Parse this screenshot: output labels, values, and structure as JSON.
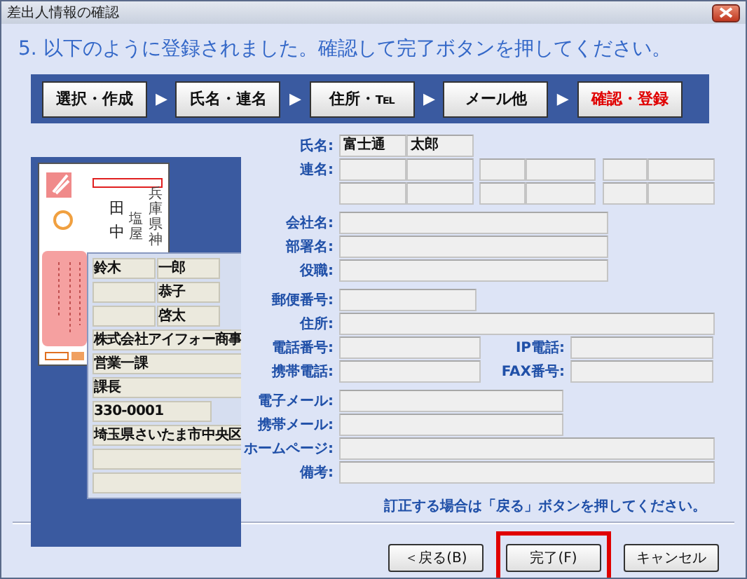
{
  "window": {
    "title": "差出人情報の確認"
  },
  "heading": "5. 以下のように登録されました。確認して完了ボタンを押してください。",
  "steps": [
    {
      "label": "選択・作成",
      "selected": false
    },
    {
      "label": "氏名・連名",
      "selected": false
    },
    {
      "label": "住所・℡",
      "selected": false
    },
    {
      "label": "メール他",
      "selected": false
    },
    {
      "label": "確認・登録",
      "selected": true
    }
  ],
  "step_separator": "▶",
  "preview": {
    "recipient": "田中",
    "address": [
      "塩屋",
      "兵庫県神"
    ],
    "entries": [
      {
        "kind": "name",
        "family": "鈴木",
        "given": "一郎"
      },
      {
        "kind": "name",
        "given": "恭子"
      },
      {
        "kind": "name",
        "given": "啓太"
      },
      {
        "kind": "wide",
        "value": "株式会社アイフォー商事"
      },
      {
        "kind": "wide",
        "value": "営業一課"
      },
      {
        "kind": "wide",
        "value": "課長"
      },
      {
        "kind": "postal",
        "value": "330-0001"
      },
      {
        "kind": "wide",
        "value": "埼玉県さいたま市中央区"
      },
      {
        "kind": "wide"
      },
      {
        "kind": "wide"
      }
    ]
  },
  "form": {
    "name": {
      "label": "氏名:",
      "family": "富士通",
      "given": "太郎"
    },
    "companions": {
      "label": "連名:"
    },
    "sections": [
      [
        {
          "kind": "medium",
          "label": "会社名:"
        },
        {
          "kind": "medium",
          "label": "部署名:"
        },
        {
          "kind": "medium",
          "label": "役職:"
        }
      ],
      [
        {
          "kind": "short",
          "label": "郵便番号:"
        },
        {
          "kind": "full",
          "label": "住所:"
        },
        {
          "kind": "pair",
          "label": "電話番号:",
          "second_label": "IP電話:"
        },
        {
          "kind": "pair",
          "label": "携帯電話:",
          "second_label": "FAX番号:"
        }
      ],
      [
        {
          "kind": "email",
          "label": "電子メール:"
        },
        {
          "kind": "email",
          "label": "携帯メール:"
        },
        {
          "kind": "full",
          "label": "ホームページ:"
        },
        {
          "kind": "full",
          "label": "備考:"
        }
      ]
    ]
  },
  "note": "訂正する場合は「戻る」ボタンを押してください。",
  "buttons": [
    {
      "label": "＜戻る(B)",
      "highlighted": false
    },
    {
      "label": "完了(F)",
      "highlighted": true
    },
    {
      "label": "キャンセル",
      "highlighted": false
    }
  ]
}
